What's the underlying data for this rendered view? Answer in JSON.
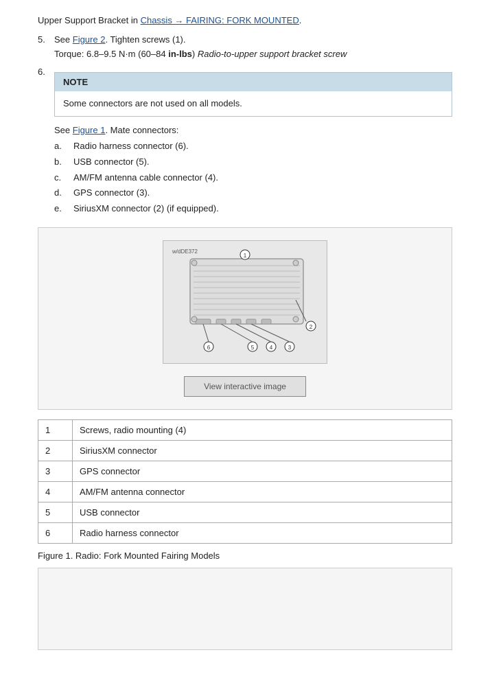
{
  "page": {
    "intro": {
      "link_text": "Chassis → FAIRING: FORK MOUNTED",
      "line1": "Upper Support Bracket in ",
      "line1_end": "."
    },
    "steps": [
      {
        "num": "5.",
        "content_pre": "See ",
        "figure_link": "Figure 2",
        "content_post": ". Tighten screws (1).",
        "torque": "Torque: 6.8–9.5 N·m (60–84 ",
        "torque_bold": "in-lbs",
        "torque_italic": "Radio-to-upper support bracket screw"
      },
      {
        "num": "6.",
        "content": ""
      }
    ],
    "note": {
      "header": "NOTE",
      "body": "Some connectors are not used on all models."
    },
    "see_line": {
      "pre": "See ",
      "link": "Figure 1",
      "post": ". Mate connectors:"
    },
    "sub_items": [
      {
        "label": "a.",
        "text": "Radio harness connector (6)."
      },
      {
        "label": "b.",
        "text": "USB connector (5)."
      },
      {
        "label": "c.",
        "text": "AM/FM antenna cable connector (4)."
      },
      {
        "label": "d.",
        "text": "GPS connector (3)."
      },
      {
        "label": "e.",
        "text": "SiriusXM connector (2) (if equipped)."
      }
    ],
    "figure": {
      "image_label": "w/dDE372",
      "button_label": "View interactive image"
    },
    "table": {
      "rows": [
        {
          "num": "1",
          "desc": "Screws, radio mounting (4)"
        },
        {
          "num": "2",
          "desc": "SiriusXM connector"
        },
        {
          "num": "3",
          "desc": "GPS connector"
        },
        {
          "num": "4",
          "desc": "AM/FM antenna connector"
        },
        {
          "num": "5",
          "desc": "USB connector"
        },
        {
          "num": "6",
          "desc": "Radio harness connector"
        }
      ]
    },
    "figure_caption": "Figure 1. Radio: Fork Mounted Fairing Models"
  }
}
